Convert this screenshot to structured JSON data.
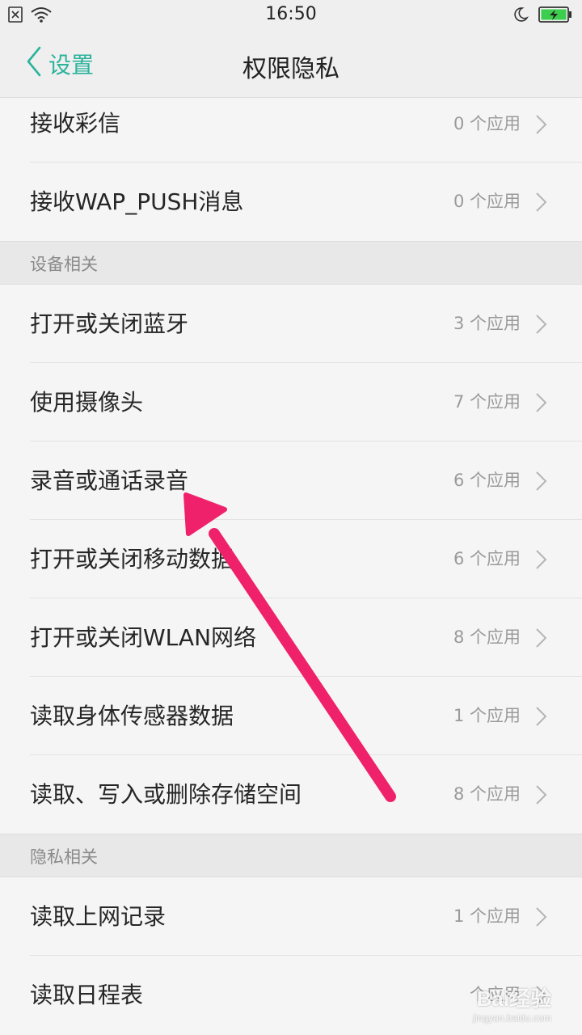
{
  "status_bar": {
    "time": "16:50",
    "icons": [
      "sim-off-icon",
      "wifi-icon",
      "moon-icon",
      "battery-charging-icon"
    ]
  },
  "header": {
    "back_label": "设置",
    "title": "权限隐私"
  },
  "rows_top": [
    {
      "label": "接收彩信",
      "count": "0 个应用"
    },
    {
      "label": "接收WAP_PUSH消息",
      "count": "0 个应用"
    }
  ],
  "section_device": {
    "title": "设备相关",
    "rows": [
      {
        "label": "打开或关闭蓝牙",
        "count": "3 个应用"
      },
      {
        "label": "使用摄像头",
        "count": "7 个应用"
      },
      {
        "label": "录音或通话录音",
        "count": "6 个应用"
      },
      {
        "label": "打开或关闭移动数据",
        "count": "6 个应用"
      },
      {
        "label": "打开或关闭WLAN网络",
        "count": "8 个应用"
      },
      {
        "label": "读取身体传感器数据",
        "count": "1 个应用"
      },
      {
        "label": "读取、写入或删除存储空间",
        "count": "8 个应用"
      }
    ]
  },
  "section_privacy": {
    "title": "隐私相关",
    "rows": [
      {
        "label": "读取上网记录",
        "count": "1 个应用"
      },
      {
        "label": "读取日程表",
        "count": "个应用"
      }
    ]
  },
  "annotation": {
    "color": "#f0216b",
    "points_to": "录音或通话录音"
  },
  "colors": {
    "accent": "#2bb39c",
    "battery": "#3ccf4e"
  },
  "watermark": {
    "main": "Bai经验",
    "url": "jingyan.baidu.com"
  }
}
